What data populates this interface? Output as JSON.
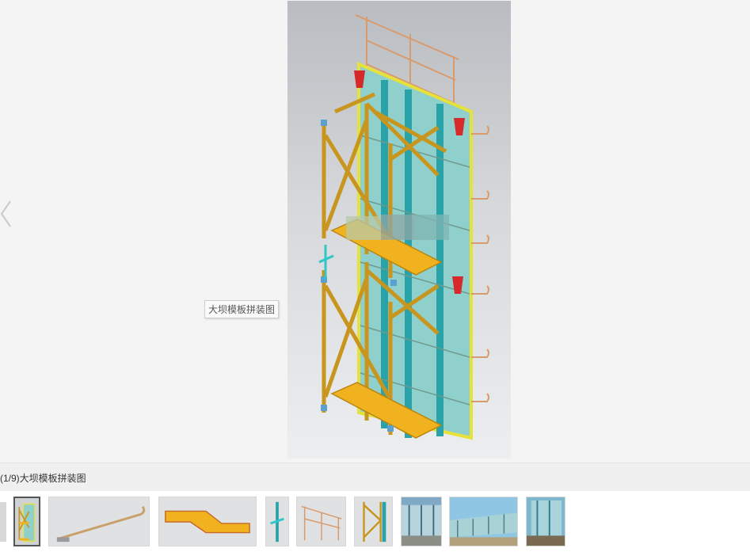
{
  "gallery": {
    "caption": "(1/9)大坝模板拼装图",
    "tooltip": "大坝模板拼装图",
    "thumbnails": [
      {
        "name": "thumb-formwork-assembly",
        "active": true
      },
      {
        "name": "thumb-anchor-rod",
        "active": false
      },
      {
        "name": "thumb-platform-board",
        "active": false
      },
      {
        "name": "thumb-connector-part",
        "active": false
      },
      {
        "name": "thumb-guardrail",
        "active": false
      },
      {
        "name": "thumb-frame-support",
        "active": false
      },
      {
        "name": "thumb-site-photo-1",
        "active": false
      },
      {
        "name": "thumb-site-photo-2",
        "active": false
      },
      {
        "name": "thumb-site-photo-3",
        "active": false
      }
    ]
  },
  "icons": {
    "prev": "chevron-left-icon",
    "thumb_prev": "thumb-scroll-left-icon"
  },
  "colors": {
    "steel_frame": "#c8961e",
    "panel": "#8fd0cc",
    "rib": "#2aa3a8",
    "platform": "#f0b21e",
    "rail": "#d99a6c",
    "bracket": "#d62a2a",
    "edge": "#e7e23a"
  }
}
